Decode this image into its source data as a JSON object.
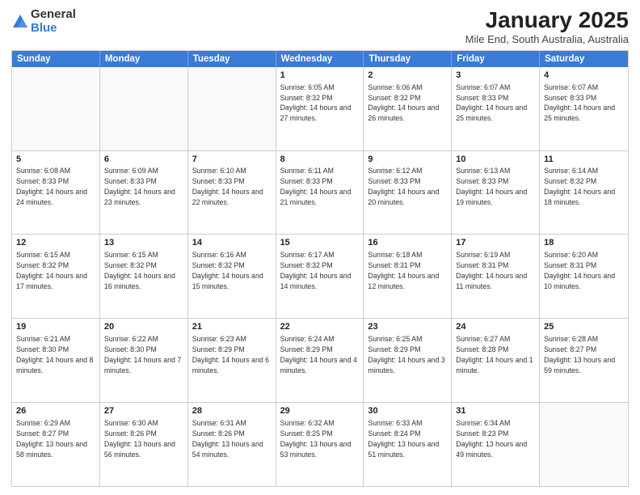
{
  "logo": {
    "general": "General",
    "blue": "Blue"
  },
  "title": {
    "month": "January 2025",
    "location": "Mile End, South Australia, Australia"
  },
  "calendar": {
    "headers": [
      "Sunday",
      "Monday",
      "Tuesday",
      "Wednesday",
      "Thursday",
      "Friday",
      "Saturday"
    ],
    "rows": [
      [
        {
          "day": "",
          "text": ""
        },
        {
          "day": "",
          "text": ""
        },
        {
          "day": "",
          "text": ""
        },
        {
          "day": "1",
          "text": "Sunrise: 6:05 AM\nSunset: 8:32 PM\nDaylight: 14 hours and 27 minutes."
        },
        {
          "day": "2",
          "text": "Sunrise: 6:06 AM\nSunset: 8:32 PM\nDaylight: 14 hours and 26 minutes."
        },
        {
          "day": "3",
          "text": "Sunrise: 6:07 AM\nSunset: 8:33 PM\nDaylight: 14 hours and 25 minutes."
        },
        {
          "day": "4",
          "text": "Sunrise: 6:07 AM\nSunset: 8:33 PM\nDaylight: 14 hours and 25 minutes."
        }
      ],
      [
        {
          "day": "5",
          "text": "Sunrise: 6:08 AM\nSunset: 8:33 PM\nDaylight: 14 hours and 24 minutes."
        },
        {
          "day": "6",
          "text": "Sunrise: 6:09 AM\nSunset: 8:33 PM\nDaylight: 14 hours and 23 minutes."
        },
        {
          "day": "7",
          "text": "Sunrise: 6:10 AM\nSunset: 8:33 PM\nDaylight: 14 hours and 22 minutes."
        },
        {
          "day": "8",
          "text": "Sunrise: 6:11 AM\nSunset: 8:33 PM\nDaylight: 14 hours and 21 minutes."
        },
        {
          "day": "9",
          "text": "Sunrise: 6:12 AM\nSunset: 8:33 PM\nDaylight: 14 hours and 20 minutes."
        },
        {
          "day": "10",
          "text": "Sunrise: 6:13 AM\nSunset: 8:33 PM\nDaylight: 14 hours and 19 minutes."
        },
        {
          "day": "11",
          "text": "Sunrise: 6:14 AM\nSunset: 8:32 PM\nDaylight: 14 hours and 18 minutes."
        }
      ],
      [
        {
          "day": "12",
          "text": "Sunrise: 6:15 AM\nSunset: 8:32 PM\nDaylight: 14 hours and 17 minutes."
        },
        {
          "day": "13",
          "text": "Sunrise: 6:15 AM\nSunset: 8:32 PM\nDaylight: 14 hours and 16 minutes."
        },
        {
          "day": "14",
          "text": "Sunrise: 6:16 AM\nSunset: 8:32 PM\nDaylight: 14 hours and 15 minutes."
        },
        {
          "day": "15",
          "text": "Sunrise: 6:17 AM\nSunset: 8:32 PM\nDaylight: 14 hours and 14 minutes."
        },
        {
          "day": "16",
          "text": "Sunrise: 6:18 AM\nSunset: 8:31 PM\nDaylight: 14 hours and 12 minutes."
        },
        {
          "day": "17",
          "text": "Sunrise: 6:19 AM\nSunset: 8:31 PM\nDaylight: 14 hours and 11 minutes."
        },
        {
          "day": "18",
          "text": "Sunrise: 6:20 AM\nSunset: 8:31 PM\nDaylight: 14 hours and 10 minutes."
        }
      ],
      [
        {
          "day": "19",
          "text": "Sunrise: 6:21 AM\nSunset: 8:30 PM\nDaylight: 14 hours and 8 minutes."
        },
        {
          "day": "20",
          "text": "Sunrise: 6:22 AM\nSunset: 8:30 PM\nDaylight: 14 hours and 7 minutes."
        },
        {
          "day": "21",
          "text": "Sunrise: 6:23 AM\nSunset: 8:29 PM\nDaylight: 14 hours and 6 minutes."
        },
        {
          "day": "22",
          "text": "Sunrise: 6:24 AM\nSunset: 8:29 PM\nDaylight: 14 hours and 4 minutes."
        },
        {
          "day": "23",
          "text": "Sunrise: 6:25 AM\nSunset: 8:29 PM\nDaylight: 14 hours and 3 minutes."
        },
        {
          "day": "24",
          "text": "Sunrise: 6:27 AM\nSunset: 8:28 PM\nDaylight: 14 hours and 1 minute."
        },
        {
          "day": "25",
          "text": "Sunrise: 6:28 AM\nSunset: 8:27 PM\nDaylight: 13 hours and 59 minutes."
        }
      ],
      [
        {
          "day": "26",
          "text": "Sunrise: 6:29 AM\nSunset: 8:27 PM\nDaylight: 13 hours and 58 minutes."
        },
        {
          "day": "27",
          "text": "Sunrise: 6:30 AM\nSunset: 8:26 PM\nDaylight: 13 hours and 56 minutes."
        },
        {
          "day": "28",
          "text": "Sunrise: 6:31 AM\nSunset: 8:26 PM\nDaylight: 13 hours and 54 minutes."
        },
        {
          "day": "29",
          "text": "Sunrise: 6:32 AM\nSunset: 8:25 PM\nDaylight: 13 hours and 53 minutes."
        },
        {
          "day": "30",
          "text": "Sunrise: 6:33 AM\nSunset: 8:24 PM\nDaylight: 13 hours and 51 minutes."
        },
        {
          "day": "31",
          "text": "Sunrise: 6:34 AM\nSunset: 8:23 PM\nDaylight: 13 hours and 49 minutes."
        },
        {
          "day": "",
          "text": ""
        }
      ]
    ]
  }
}
